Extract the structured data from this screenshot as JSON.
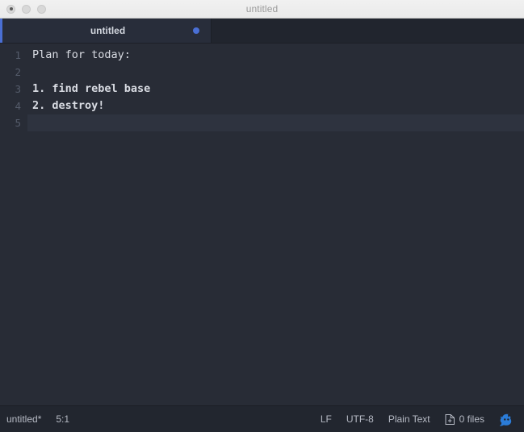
{
  "window": {
    "title": "untitled",
    "traffic_lights": [
      {
        "name": "close-button",
        "label": "close"
      },
      {
        "name": "minimize-button",
        "label": "minimize"
      },
      {
        "name": "zoom-button",
        "label": "zoom"
      }
    ]
  },
  "tabs": [
    {
      "label": "untitled",
      "modified": true,
      "active": true
    }
  ],
  "editor": {
    "lines": [
      {
        "number": "1",
        "text": "Plan for today:",
        "bold": false,
        "active": false
      },
      {
        "number": "2",
        "text": "",
        "bold": false,
        "active": false
      },
      {
        "number": "3",
        "text": "1. find rebel base",
        "bold": true,
        "active": false
      },
      {
        "number": "4",
        "text": "2. destroy!",
        "bold": true,
        "active": false
      },
      {
        "number": "5",
        "text": "",
        "bold": false,
        "active": true
      }
    ]
  },
  "statusbar": {
    "filename": "untitled*",
    "cursor_position": "5:1",
    "line_ending": "LF",
    "encoding": "UTF-8",
    "grammar": "Plain Text",
    "files_count": "0 files",
    "file_icon_name": "new-file-icon",
    "github_icon_name": "octoface-icon"
  },
  "colors": {
    "titlebar_bg": "#efefef",
    "titlebar_text": "#9b9b9b",
    "tabbar_bg": "#21252e",
    "tab_bg": "#282d3a",
    "accent_blue": "#4a6fd4",
    "editor_bg": "#282c36",
    "editor_text": "#d9dce3",
    "gutter_text": "#555c6b",
    "active_line_bg": "#2e333f",
    "statusbar_bg": "#22262f",
    "statusbar_text": "#b6bac4",
    "octo_blue": "#2b7cd8"
  }
}
